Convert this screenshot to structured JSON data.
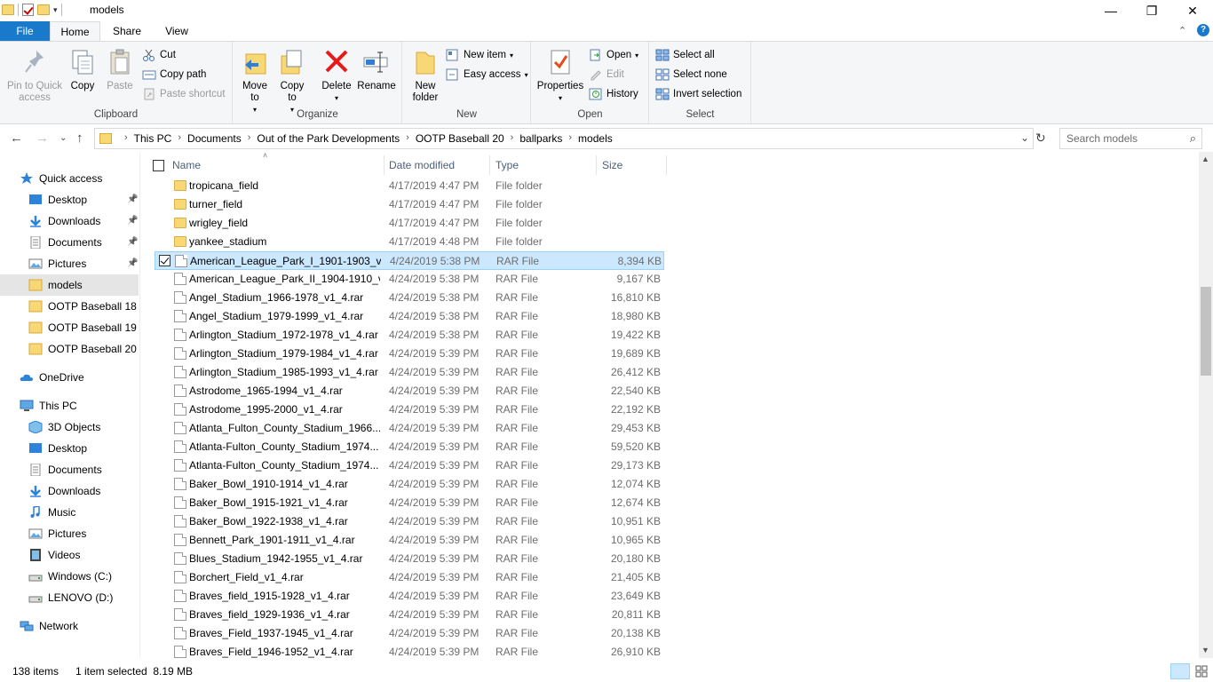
{
  "window": {
    "title": "models",
    "minimize": "—",
    "maximize": "❐",
    "close": "✕"
  },
  "ribbon_tabs": {
    "file": "File",
    "home": "Home",
    "share": "Share",
    "view": "View"
  },
  "ribbon": {
    "clipboard": {
      "label": "Clipboard",
      "pin": "Pin to Quick access",
      "copy": "Copy",
      "paste": "Paste",
      "cut": "Cut",
      "copy_path": "Copy path",
      "paste_shortcut": "Paste shortcut"
    },
    "organize": {
      "label": "Organize",
      "move_to": "Move to",
      "copy_to": "Copy to",
      "delete": "Delete",
      "rename": "Rename"
    },
    "new": {
      "label": "New",
      "new_folder": "New folder",
      "new_item": "New item",
      "easy_access": "Easy access"
    },
    "open": {
      "label": "Open",
      "properties": "Properties",
      "open": "Open",
      "edit": "Edit",
      "history": "History"
    },
    "select": {
      "label": "Select",
      "select_all": "Select all",
      "select_none": "Select none",
      "invert": "Invert selection"
    }
  },
  "address": {
    "crumbs": [
      "This PC",
      "Documents",
      "Out of the Park Developments",
      "OOTP Baseball 20",
      "ballparks",
      "models"
    ],
    "search_placeholder": "Search models"
  },
  "nav": {
    "quick_access": "Quick access",
    "qa_items": [
      "Desktop",
      "Downloads",
      "Documents",
      "Pictures",
      "models",
      "OOTP Baseball 18",
      "OOTP Baseball 19",
      "OOTP Baseball 20"
    ],
    "onedrive": "OneDrive",
    "this_pc": "This PC",
    "pc_items": [
      "3D Objects",
      "Desktop",
      "Documents",
      "Downloads",
      "Music",
      "Pictures",
      "Videos",
      "Windows (C:)",
      "LENOVO (D:)"
    ],
    "network": "Network"
  },
  "columns": {
    "name": "Name",
    "date": "Date modified",
    "type": "Type",
    "size": "Size"
  },
  "files": [
    {
      "name": "tropicana_field",
      "date": "4/17/2019 4:47 PM",
      "type": "File folder",
      "size": "",
      "folder": true
    },
    {
      "name": "turner_field",
      "date": "4/17/2019 4:47 PM",
      "type": "File folder",
      "size": "",
      "folder": true
    },
    {
      "name": "wrigley_field",
      "date": "4/17/2019 4:47 PM",
      "type": "File folder",
      "size": "",
      "folder": true
    },
    {
      "name": "yankee_stadium",
      "date": "4/17/2019 4:48 PM",
      "type": "File folder",
      "size": "",
      "folder": true
    },
    {
      "name": "American_League_Park_I_1901-1903_v...",
      "date": "4/24/2019 5:38 PM",
      "type": "RAR File",
      "size": "8,394 KB",
      "selected": true
    },
    {
      "name": "American_League_Park_II_1904-1910_v...",
      "date": "4/24/2019 5:38 PM",
      "type": "RAR File",
      "size": "9,167 KB"
    },
    {
      "name": "Angel_Stadium_1966-1978_v1_4.rar",
      "date": "4/24/2019 5:38 PM",
      "type": "RAR File",
      "size": "16,810 KB"
    },
    {
      "name": "Angel_Stadium_1979-1999_v1_4.rar",
      "date": "4/24/2019 5:38 PM",
      "type": "RAR File",
      "size": "18,980 KB"
    },
    {
      "name": "Arlington_Stadium_1972-1978_v1_4.rar",
      "date": "4/24/2019 5:38 PM",
      "type": "RAR File",
      "size": "19,422 KB"
    },
    {
      "name": "Arlington_Stadium_1979-1984_v1_4.rar",
      "date": "4/24/2019 5:39 PM",
      "type": "RAR File",
      "size": "19,689 KB"
    },
    {
      "name": "Arlington_Stadium_1985-1993_v1_4.rar",
      "date": "4/24/2019 5:39 PM",
      "type": "RAR File",
      "size": "26,412 KB"
    },
    {
      "name": "Astrodome_1965-1994_v1_4.rar",
      "date": "4/24/2019 5:39 PM",
      "type": "RAR File",
      "size": "22,540 KB"
    },
    {
      "name": "Astrodome_1995-2000_v1_4.rar",
      "date": "4/24/2019 5:39 PM",
      "type": "RAR File",
      "size": "22,192 KB"
    },
    {
      "name": "Atlanta_Fulton_County_Stadium_1966...",
      "date": "4/24/2019 5:39 PM",
      "type": "RAR File",
      "size": "29,453 KB"
    },
    {
      "name": "Atlanta-Fulton_County_Stadium_1974...",
      "date": "4/24/2019 5:39 PM",
      "type": "RAR File",
      "size": "59,520 KB"
    },
    {
      "name": "Atlanta-Fulton_County_Stadium_1974...",
      "date": "4/24/2019 5:39 PM",
      "type": "RAR File",
      "size": "29,173 KB"
    },
    {
      "name": "Baker_Bowl_1910-1914_v1_4.rar",
      "date": "4/24/2019 5:39 PM",
      "type": "RAR File",
      "size": "12,074 KB"
    },
    {
      "name": "Baker_Bowl_1915-1921_v1_4.rar",
      "date": "4/24/2019 5:39 PM",
      "type": "RAR File",
      "size": "12,674 KB"
    },
    {
      "name": "Baker_Bowl_1922-1938_v1_4.rar",
      "date": "4/24/2019 5:39 PM",
      "type": "RAR File",
      "size": "10,951 KB"
    },
    {
      "name": "Bennett_Park_1901-1911_v1_4.rar",
      "date": "4/24/2019 5:39 PM",
      "type": "RAR File",
      "size": "10,965 KB"
    },
    {
      "name": "Blues_Stadium_1942-1955_v1_4.rar",
      "date": "4/24/2019 5:39 PM",
      "type": "RAR File",
      "size": "20,180 KB"
    },
    {
      "name": "Borchert_Field_v1_4.rar",
      "date": "4/24/2019 5:39 PM",
      "type": "RAR File",
      "size": "21,405 KB"
    },
    {
      "name": "Braves_field_1915-1928_v1_4.rar",
      "date": "4/24/2019 5:39 PM",
      "type": "RAR File",
      "size": "23,649 KB"
    },
    {
      "name": "Braves_field_1929-1936_v1_4.rar",
      "date": "4/24/2019 5:39 PM",
      "type": "RAR File",
      "size": "20,811 KB"
    },
    {
      "name": "Braves_Field_1937-1945_v1_4.rar",
      "date": "4/24/2019 5:39 PM",
      "type": "RAR File",
      "size": "20,138 KB"
    },
    {
      "name": "Braves_Field_1946-1952_v1_4.rar",
      "date": "4/24/2019 5:39 PM",
      "type": "RAR File",
      "size": "26,910 KB"
    }
  ],
  "status": {
    "count": "138 items",
    "selected": "1 item selected  8.19 MB"
  },
  "colors": {
    "accent": "#1979ca",
    "selection": "#cce8ff",
    "folder": "#f8d775"
  }
}
